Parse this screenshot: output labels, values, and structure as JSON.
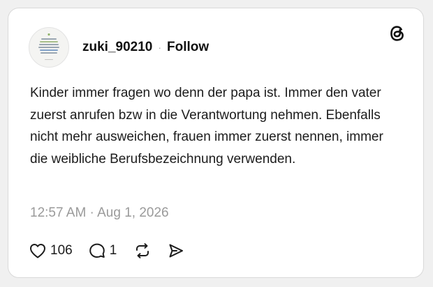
{
  "post": {
    "username": "zuki_90210",
    "separator": "·",
    "follow_label": "Follow",
    "text": "Kinder immer fragen wo denn der papa ist. Immer den vater zuerst anrufen bzw in die Verantwortung nehmen. Ebenfalls nicht mehr ausweichen, frauen immer zuerst nennen, immer die weibliche Berufsbezeichnung verwenden.",
    "timestamp": "12:57 AM · Aug 1, 2026"
  },
  "stats": {
    "likes": "106",
    "replies": "1"
  },
  "icons": {
    "brand": "threads-logo-icon",
    "like": "heart-icon",
    "reply": "comment-bubble-icon",
    "repost": "repost-icon",
    "share": "send-icon"
  },
  "colors": {
    "card_background": "#ffffff",
    "page_background": "#f0f0f0",
    "text": "#1c1c1c",
    "muted": "#9a9a9a",
    "border": "#d9d9d9"
  }
}
